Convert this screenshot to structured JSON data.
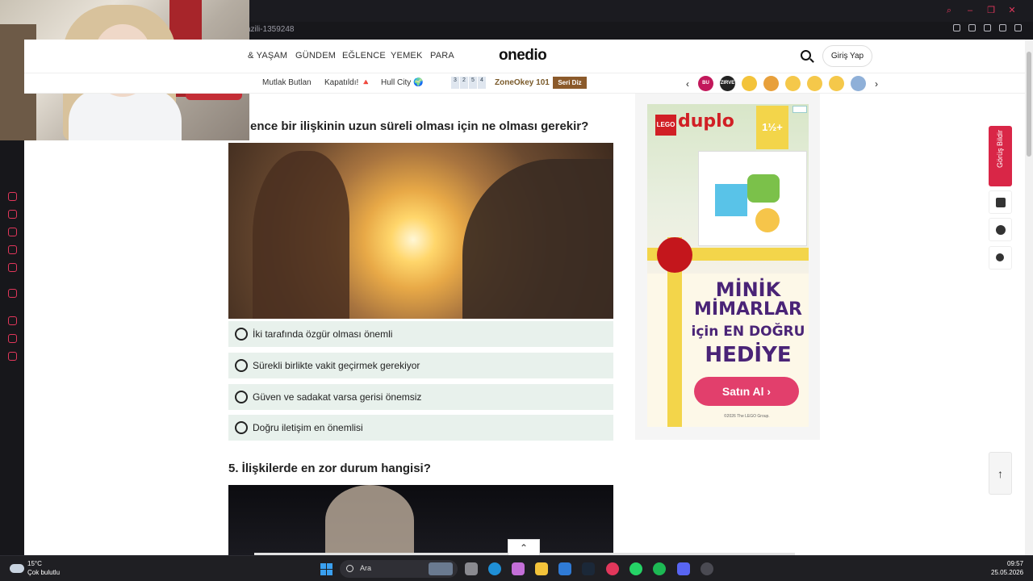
{
  "browser": {
    "url_fragment": "yazili-1359248"
  },
  "site": {
    "logo": "onedio",
    "nav": [
      "& YAŞAM",
      "GÜNDEM",
      "EĞLENCE",
      "YEMEK",
      "PARA"
    ],
    "login_label": "Giriş Yap",
    "subnav": [
      "Mutlak Butlan",
      "Kapatıldı! 🔺",
      "Hull City 🌍"
    ],
    "zone_digits": [
      "3",
      "2",
      "5",
      "4"
    ],
    "zone_label": "ZoneOkey 101",
    "seri_badge": "Seri Diz",
    "emoji_labels": [
      "BU POST",
      "ZIRVE MI?"
    ]
  },
  "quiz": {
    "question_title": "ence bir ilişkinin uzun süreli olması için ne olması gerekir?",
    "options": [
      "İki tarafında özgür olması önemli",
      "Sürekli birlikte vakit geçirmek gerekiyor",
      "Güven ve sadakat varsa gerisi önemsiz",
      "Doğru iletişim en önemlisi"
    ],
    "next_question_title": "5. İlişkilerde en zor durum hangisi?"
  },
  "ad": {
    "brand_small": "LEGO",
    "brand": "duplo",
    "age": "1½+",
    "headline_1": "MİNİK",
    "headline_2": "MİMARLAR",
    "headline_3": "için EN DOĞRU",
    "headline_4": "HEDİYE",
    "cta": "Satın Al ›",
    "legal": "©2026 The LEGO Group."
  },
  "right_tools": {
    "feedback_label": "Görüş Bildir",
    "back_to_top": "↑"
  },
  "taskbar": {
    "temp": "15°C",
    "weather": "Çok bulutlu",
    "search_label": "Ara",
    "time": "09:57",
    "date": "25.05.2026"
  },
  "colors": {
    "accent": "#e2375b",
    "option_bg": "#e8f1ec",
    "feedback_bg": "#d92647",
    "cta_bg": "#e23f6c",
    "ad_headline": "#4a2477"
  }
}
